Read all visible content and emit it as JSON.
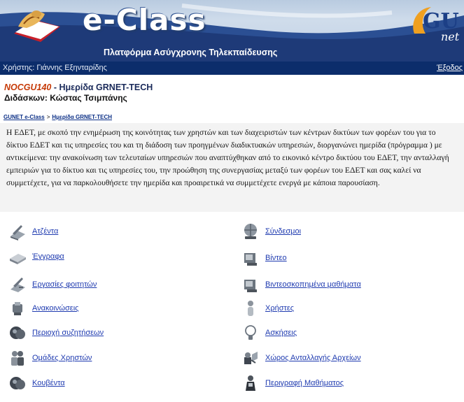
{
  "header": {
    "logo_text": "e-Class",
    "subtitle": "Πλατφόρμα Ασύγχρονης Τηλεκπαίδευσης",
    "partner_logo_text": "GUnet"
  },
  "userbar": {
    "user": "Χρήστης: Γιάννης Εξηνταρίδης",
    "logout": "Έξοδος"
  },
  "course": {
    "code": "NOCGU140",
    "separator": " - ",
    "title": "Ημερίδα GRNET-TECH",
    "teacher": "Διδάσκων: Κώστας Τσιμπάνης"
  },
  "breadcrumb": {
    "home": "GUNET e-Class",
    "sep": ">",
    "current": "Ημερίδα GRNET-TECH"
  },
  "description": "Η ΕΔΕΤ, με σκοπό την ενημέρωση της κοινότητας των χρηστών και των διαχειριστών των κέντρων δικτύων των φορέων του για το δίκτυο ΕΔΕΤ και τις υπηρεσίες του και τη διάδοση των προηγμένων διαδικτυακών υπηρεσιών, διοργανώνει ημερίδα (πρόγραμμα ) με αντικείμενα: την ανακοίνωση των τελευταίων υπηρεσιών που αναπτύχθηκαν από το εικονικό κέντρο δικτύου του ΕΔΕΤ, την ανταλλαγή εμπειριών για το δίκτυο και τις υπηρεσίες του, την προώθηση της συνεργασίας μεταξύ των φορέων του ΕΔΕΤ και σας καλεί να συμμετέχετε, για να παρκολουθήσετε την ημερίδα και προαιρετικά να συμμετέχετε ενεργά με κάποια παρουσίαση.",
  "tools_left": [
    {
      "label": "Ατζέντα",
      "icon": "agenda-icon"
    },
    {
      "label": "Έγγραφα",
      "icon": "documents-icon"
    },
    {
      "label": "Εργασίες φοιτητών",
      "icon": "assignments-icon"
    },
    {
      "label": "Ανακοινώσεις",
      "icon": "announcements-icon"
    },
    {
      "label": "Περιοχή συζητήσεων",
      "icon": "forum-icon"
    },
    {
      "label": "Ομάδες Χρηστών",
      "icon": "groups-icon"
    },
    {
      "label": "Κουβέντα",
      "icon": "chat-icon"
    }
  ],
  "tools_right": [
    {
      "label": "Σύνδεσμοι",
      "icon": "links-icon"
    },
    {
      "label": "Βίντεο",
      "icon": "video-icon"
    },
    {
      "label": "Βιντεοσκοπημένα μαθήματα",
      "icon": "video-lessons-icon"
    },
    {
      "label": "Χρήστες",
      "icon": "users-icon"
    },
    {
      "label": "Ασκήσεις",
      "icon": "exercises-icon"
    },
    {
      "label": "Χώρος Ανταλλαγής Αρχείων",
      "icon": "file-exchange-icon"
    },
    {
      "label": "Περιγραφή Μαθήματος",
      "icon": "course-description-icon"
    }
  ]
}
